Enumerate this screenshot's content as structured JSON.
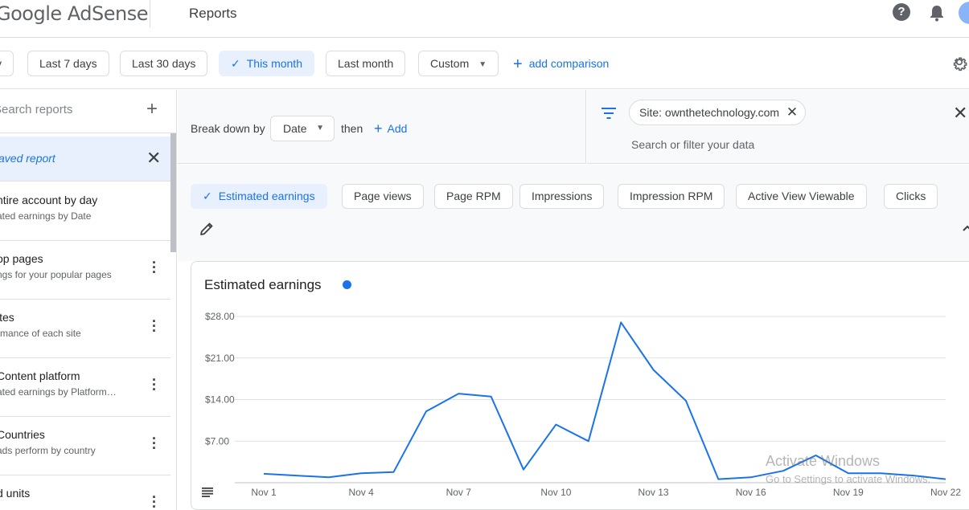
{
  "header": {
    "logo_text": "Google AdSense",
    "title": "Reports"
  },
  "date_filters": {
    "items": [
      {
        "label": "y"
      },
      {
        "label": "Last 7 days"
      },
      {
        "label": "Last 30 days"
      },
      {
        "label": "This month",
        "selected": true
      },
      {
        "label": "Last month"
      },
      {
        "label": "Custom"
      }
    ],
    "add_comparison": "add comparison"
  },
  "sidebar": {
    "search_placeholder": "Search reports",
    "saved_report": "aved report",
    "reports": [
      {
        "title": "ntire account by day",
        "subtitle": "ated earnings by Date"
      },
      {
        "title": "op pages",
        "subtitle": "ngs for your popular pages"
      },
      {
        "title": "ites",
        "subtitle": "rmance of each site"
      },
      {
        "title": "Content platform",
        "subtitle": "ated earnings by Platform…"
      },
      {
        "title": "Countries",
        "subtitle": "ads perform by country"
      },
      {
        "title": "d units",
        "subtitle": ""
      }
    ]
  },
  "breakdown": {
    "label": "Break down by",
    "dimension": "Date",
    "then": "then",
    "add": "Add"
  },
  "filter": {
    "site_chip": "Site: ownthetechnology.com",
    "placeholder": "Search or filter your data"
  },
  "metrics": [
    {
      "label": "Estimated earnings",
      "selected": true
    },
    {
      "label": "Page views"
    },
    {
      "label": "Page RPM"
    },
    {
      "label": "Impressions"
    },
    {
      "label": "Impression RPM"
    },
    {
      "label": "Active View Viewable"
    },
    {
      "label": "Clicks"
    }
  ],
  "chart_data": {
    "type": "line",
    "title": "Estimated earnings",
    "x": [
      "Nov 1",
      "Nov 2",
      "Nov 3",
      "Nov 4",
      "Nov 5",
      "Nov 6",
      "Nov 7",
      "Nov 8",
      "Nov 9",
      "Nov 10",
      "Nov 11",
      "Nov 12",
      "Nov 13",
      "Nov 14",
      "Nov 15",
      "Nov 16",
      "Nov 17",
      "Nov 18",
      "Nov 19",
      "Nov 20",
      "Nov 21",
      "Nov 22"
    ],
    "x_tick_labels": [
      "Nov 1",
      "Nov 4",
      "Nov 7",
      "Nov 10",
      "Nov 13",
      "Nov 16",
      "Nov 19",
      "Nov 22"
    ],
    "series": [
      {
        "values": [
          1.5,
          1.2,
          0.9,
          1.6,
          1.8,
          12.0,
          15.0,
          14.5,
          2.2,
          9.8,
          7.0,
          27.0,
          19.0,
          13.8,
          0.6,
          0.9,
          2.0,
          4.6,
          1.6,
          1.6,
          1.2,
          0.6
        ]
      }
    ],
    "y_ticks": [
      7,
      14,
      21,
      28
    ],
    "y_tick_labels": [
      "$7.00",
      "$14.00",
      "$21.00",
      "$28.00"
    ],
    "ylim": [
      0,
      28
    ],
    "color": "#1a73e8",
    "grid": true
  },
  "watermark": {
    "line1": "Activate Windows",
    "line2": "Go to Settings to activate Windows."
  }
}
